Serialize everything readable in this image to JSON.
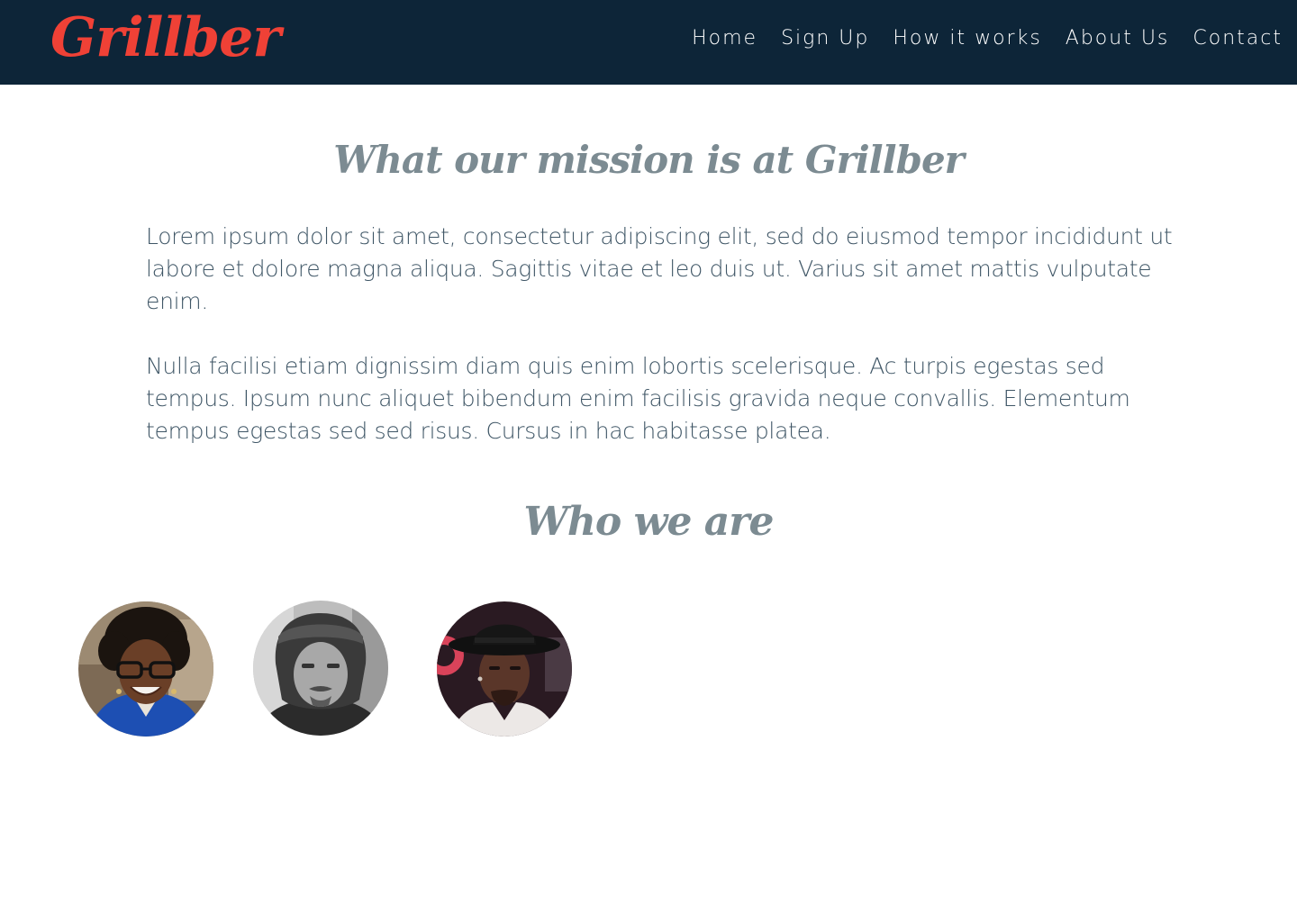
{
  "brand": {
    "logo_text": "Grillber",
    "logo_color": "#ef4136",
    "navbar_color": "#0d2538"
  },
  "nav": {
    "items": [
      {
        "label": "Home"
      },
      {
        "label": "Sign Up"
      },
      {
        "label": "How it works"
      },
      {
        "label": "About Us"
      },
      {
        "label": "Contact"
      }
    ]
  },
  "mission": {
    "heading": "What our mission is at Grillber",
    "paragraphs": [
      "Lorem ipsum dolor sit amet, consectetur adipiscing elit, sed do eiusmod tempor incididunt ut labore et dolore magna aliqua. Sagittis vitae et leo duis ut. Varius sit amet mattis vulputate enim.",
      "Nulla facilisi etiam dignissim diam quis enim lobortis scelerisque. Ac turpis egestas sed tempus. Ipsum nunc aliquet bibendum enim facilisis gravida neque convallis. Elementum tempus egestas sed sed risus. Cursus in hac habitasse platea."
    ]
  },
  "team": {
    "heading": "Who we are",
    "members": [
      {
        "photo": "woman-glasses-smiling-photo"
      },
      {
        "photo": "man-beanie-grayscale-photo"
      },
      {
        "photo": "man-hat-neon-photo"
      }
    ]
  },
  "colors": {
    "heading": "#7c8b92",
    "body_text": "#3f5666",
    "background": "#ffffff"
  }
}
